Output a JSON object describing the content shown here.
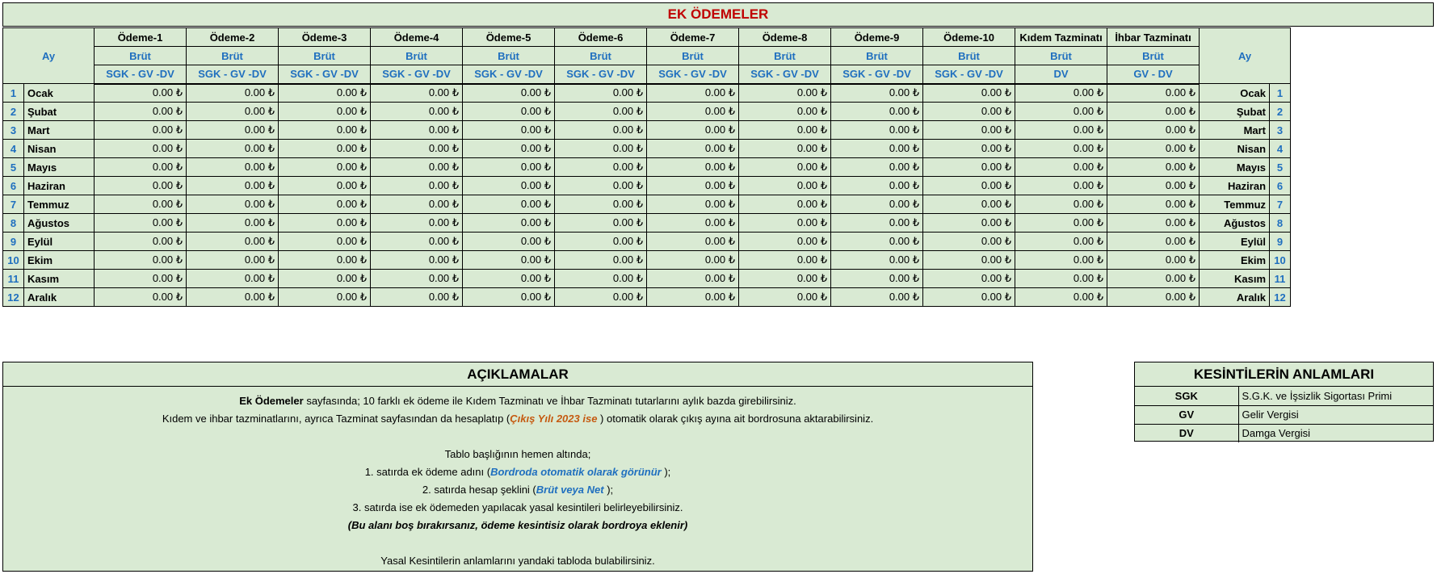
{
  "title": "EK ÖDEMELER",
  "ay_label": "Ay",
  "columns": [
    {
      "name": "Ödeme-1",
      "type": "Brüt",
      "deductions": "SGK - GV -DV"
    },
    {
      "name": "Ödeme-2",
      "type": "Brüt",
      "deductions": "SGK - GV -DV"
    },
    {
      "name": "Ödeme-3",
      "type": "Brüt",
      "deductions": "SGK - GV -DV"
    },
    {
      "name": "Ödeme-4",
      "type": "Brüt",
      "deductions": "SGK - GV -DV"
    },
    {
      "name": "Ödeme-5",
      "type": "Brüt",
      "deductions": "SGK - GV -DV"
    },
    {
      "name": "Ödeme-6",
      "type": "Brüt",
      "deductions": "SGK - GV -DV"
    },
    {
      "name": "Ödeme-7",
      "type": "Brüt",
      "deductions": "SGK - GV -DV"
    },
    {
      "name": "Ödeme-8",
      "type": "Brüt",
      "deductions": "SGK - GV -DV"
    },
    {
      "name": "Ödeme-9",
      "type": "Brüt",
      "deductions": "SGK - GV -DV"
    },
    {
      "name": "Ödeme-10",
      "type": "Brüt",
      "deductions": "SGK - GV -DV"
    },
    {
      "name": "Kıdem Tazminatı",
      "type": "Brüt",
      "deductions": "DV"
    },
    {
      "name": "İhbar Tazminatı",
      "type": "Brüt",
      "deductions": "GV - DV"
    }
  ],
  "months": [
    {
      "no": "1",
      "name": "Ocak"
    },
    {
      "no": "2",
      "name": "Şubat"
    },
    {
      "no": "3",
      "name": "Mart"
    },
    {
      "no": "4",
      "name": "Nisan"
    },
    {
      "no": "5",
      "name": "Mayıs"
    },
    {
      "no": "6",
      "name": "Haziran"
    },
    {
      "no": "7",
      "name": "Temmuz"
    },
    {
      "no": "8",
      "name": "Ağustos"
    },
    {
      "no": "9",
      "name": "Eylül"
    },
    {
      "no": "10",
      "name": "Ekim"
    },
    {
      "no": "11",
      "name": "Kasım"
    },
    {
      "no": "12",
      "name": "Aralık"
    }
  ],
  "cell_value": "0.00 ₺",
  "aciklamalar": {
    "title": "AÇIKLAMALAR",
    "l1_bold": "Ek Ödemeler",
    "l1_rest": " sayfasında; 10 farklı ek ödeme ile Kıdem Tazminatı ve İhbar Tazminatı tutarlarını aylık bazda girebilirsiniz.",
    "l2_a": "Kıdem ve ihbar tazminatlarını, ayrıca Tazminat sayfasından da hesaplatıp (",
    "l2_b": "Çıkış Yılı 2023 ise",
    "l2_c": " ) otomatik olarak çıkış ayına ait bordrosuna aktarabilirsiniz.",
    "l3": "Tablo başlığının hemen altında;",
    "l4_a": "1. satırda ek ödeme adını (",
    "l4_b": "Bordroda otomatik olarak görünür",
    "l4_c": " );",
    "l5_a": "2. satırda hesap şeklini (",
    "l5_b": "Brüt veya Net",
    "l5_c": " );",
    "l6": "3. satırda ise ek ödemeden yapılacak yasal kesintileri belirleyebilirsiniz.",
    "l7": "(Bu alanı boş bırakırsanız, ödeme kesintisiz olarak bordroya eklenir)",
    "l8": "Yasal Kesintilerin anlamlarını yandaki tabloda bulabilirsiniz."
  },
  "kesintiler": {
    "title": "KESİNTİLERİN ANLAMLARI",
    "items": [
      {
        "code": "SGK",
        "meaning": "S.G.K. ve İşsizlik Sigortası Primi"
      },
      {
        "code": "GV",
        "meaning": "Gelir Vergisi"
      },
      {
        "code": "DV",
        "meaning": "Damga Vergisi"
      }
    ]
  }
}
